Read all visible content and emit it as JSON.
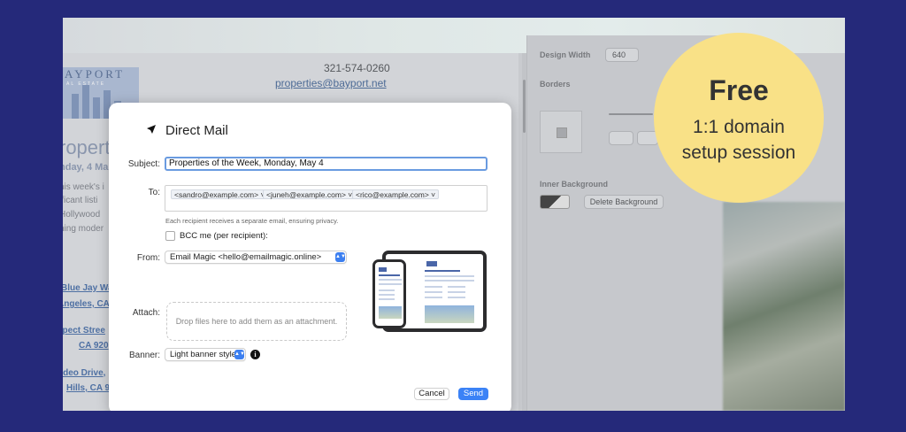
{
  "background_page": {
    "logo_word": "AYPORT",
    "logo_subtitle": "AL ESTATE",
    "phone": "321-574-0260",
    "email": "properties@bayport.net",
    "heading": "ropert",
    "date": "nday, 4 Ma",
    "body_lines": [
      "his week's i",
      "ificant listi",
      "Hollywood",
      "ning moder"
    ],
    "addresses": [
      "Blue Jay Wa",
      "Angeles, CA",
      "spect Stree",
      "CA 920",
      "odeo Drive,",
      "Hills, CA 9"
    ]
  },
  "panel": {
    "design_width_label": "Design Width",
    "design_width_value": "640",
    "borders_label": "Borders",
    "inner_background_label": "Inner Background",
    "delete_background": "Delete Background"
  },
  "dialog": {
    "title": "Direct Mail",
    "subject_label": "Subject:",
    "subject_value": "Properties of the Week, Monday, May 4",
    "to_label": "To:",
    "recipients": [
      "<sandro@example.com>",
      "<juneh@example.com>",
      "<rico@example.com>"
    ],
    "privacy_hint": "Each recipient receives a separate email, ensuring privacy.",
    "bcc_label": "BCC me (per recipient):",
    "from_label": "From:",
    "from_value": "Email Magic <hello@emailmagic.online>",
    "attach_label": "Attach:",
    "attach_hint": "Drop files here to add them as an attachment.",
    "banner_label": "Banner:",
    "banner_value": "Light banner style",
    "cancel": "Cancel",
    "send": "Send"
  },
  "badge": {
    "headline": "Free",
    "line1": "1:1 domain",
    "line2": "setup session"
  },
  "colors": {
    "frame": "#25297a",
    "badge": "#f9e187",
    "accent": "#3b82f6"
  }
}
